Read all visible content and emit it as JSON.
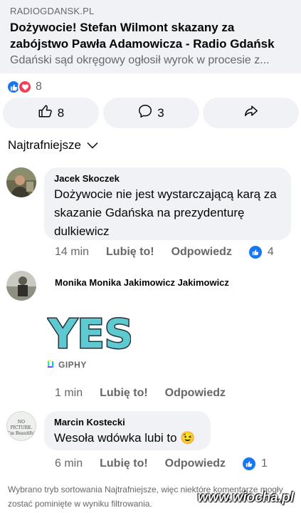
{
  "link_preview": {
    "domain": "RADIOGDANSK.PL",
    "title": "Dożywocie! Stefan Wilmont skazany za zabójstwo Pawła Adamowicza - Radio Gdańsk",
    "description": "Gdański sąd okręgowy ogłosił wyrok w procesie z..."
  },
  "reactions": {
    "count": "8"
  },
  "actions": {
    "like_count": "8",
    "comment_count": "3"
  },
  "sort": {
    "label": "Najtrafniejsze"
  },
  "comments": [
    {
      "author": "Jacek Skoczek",
      "text": "Dożywocie nie jest wystarczającą karą za skazanie Gdańska na prezydenturę dulkiewicz",
      "time": "14 min",
      "like_label": "Lubię to!",
      "reply_label": "Odpowiedz",
      "likes": "4"
    },
    {
      "author": "Monika Monika Jakimowicz Jakimowicz",
      "gif_text": "YES",
      "gif_source": "GIPHY",
      "time": "1 min",
      "like_label": "Lubię to!",
      "reply_label": "Odpowiedz"
    },
    {
      "author": "Marcin Kostecki",
      "text": "Wesoła wdówka lubi to 😉",
      "avatar_text": "NO PICTURE. I'm Beautiful",
      "time": "6 min",
      "like_label": "Lubię to!",
      "reply_label": "Odpowiedz",
      "likes": "1"
    }
  ],
  "footer_note": "Wybrano tryb sortowania Najtrafniejsze, więc niektóre komentarze mogły zostać pominięte w wyniku filtrowania.",
  "watermark": "www.wiocha.pl",
  "colors": {
    "accent": "#1877f2",
    "love": "#f33e58",
    "bubble": "#f0f2f5",
    "muted": "#65676b",
    "gif": "#5ec9cf"
  }
}
